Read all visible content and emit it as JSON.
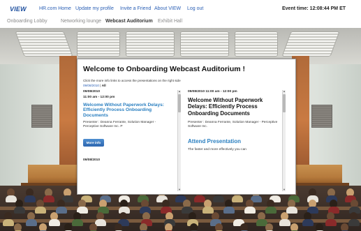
{
  "topnav": {
    "logo": "VIEW",
    "links": [
      "HR.com Home",
      "Update my profile",
      "Invite a Friend",
      "About VIEW",
      "Log out"
    ],
    "event_time": "Event time: 12:08:44 PM   ET"
  },
  "subnav": {
    "tabs": [
      "Onboarding Lobby",
      "Networking lounge",
      "Webcast Auditorium",
      "Exhibit Hall"
    ],
    "active_tab": "Webcast Auditorium"
  },
  "screen": {
    "title": "Welcome to Onboarding Webcast Auditorium !",
    "instructions": "Click the more info links to access the presentations on the right side",
    "date_filter": {
      "date": "09/08/2010",
      "separator": "|",
      "all": "All"
    },
    "list": {
      "items": [
        {
          "date": "09/08/2010",
          "time": "11:00 am - 12:00 pm",
          "title": "Welcome Without Paperwork Delays: Efficiently Process Onboarding Documents",
          "presenter": "Presenter : Deanna Ferrante, Solution Manager - Perceptive Software Inc. P",
          "button": "More info"
        },
        {
          "date": "09/08/2010"
        }
      ]
    },
    "detail": {
      "datetime": "09/08/2010 11:00 am - 12:00 pm",
      "title": "Welcome Without Paperwork Delays: Efficiently Process Onboarding Documents",
      "presenter": "Presenter : Deanna Ferrante, Solution Manager - Perceptive Software Inc.",
      "attend": "Attend Presentation",
      "description": "The faster and more effectively you can"
    }
  },
  "colors": {
    "link_blue": "#2a5fb5",
    "title_blue": "#2a7fc0",
    "button_blue": "#2d66b0",
    "stage_wood": "#b67a3c"
  },
  "icons": {
    "scroll_up": "triangle-up-icon",
    "scroll_down": "triangle-down-icon"
  }
}
